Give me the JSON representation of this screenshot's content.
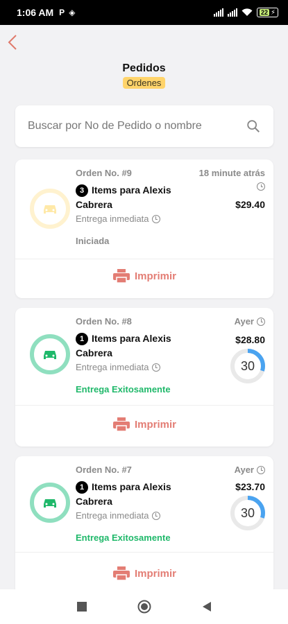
{
  "status_bar": {
    "time": "1:06 AM",
    "battery": "22"
  },
  "header": {
    "title": "Pedidos",
    "subtitle": "Ordenes"
  },
  "search": {
    "placeholder": "Buscar por No de Pedido o nombre"
  },
  "orders": [
    {
      "order_no": "Orden No. #9",
      "count": "3",
      "items": "Items para Alexis Cabrera",
      "delivery": "Entrega inmediata",
      "status": "Iniciada",
      "time": "18 minute atrás",
      "price": "$29.40",
      "print_label": "Imprimir",
      "status_color": "#8a8a8a",
      "icon_color": "#ffe9a8"
    },
    {
      "order_no": "Orden No. #8",
      "count": "1",
      "items": "Items para Alexis Cabrera",
      "delivery": "Entrega inmediata",
      "status": "Entrega Exitosamente",
      "time": "Ayer",
      "price": "$28.80",
      "progress_label": "30",
      "progress_fraction": 0.3,
      "print_label": "Imprimir",
      "status_color": "#1fb86a",
      "icon_color": "#8fdfbf"
    },
    {
      "order_no": "Orden No. #7",
      "count": "1",
      "items": "Items para Alexis Cabrera",
      "delivery": "Entrega inmediata",
      "status": "Entrega Exitosamente",
      "time": "Ayer",
      "price": "$23.70",
      "progress_label": "30",
      "progress_fraction": 0.3,
      "print_label": "Imprimir",
      "status_color": "#1fb86a",
      "icon_color": "#8fdfbf"
    }
  ],
  "colors": {
    "accent": "#e37d74",
    "badge": "#ffd46b",
    "ring": "#4aa3f0"
  }
}
